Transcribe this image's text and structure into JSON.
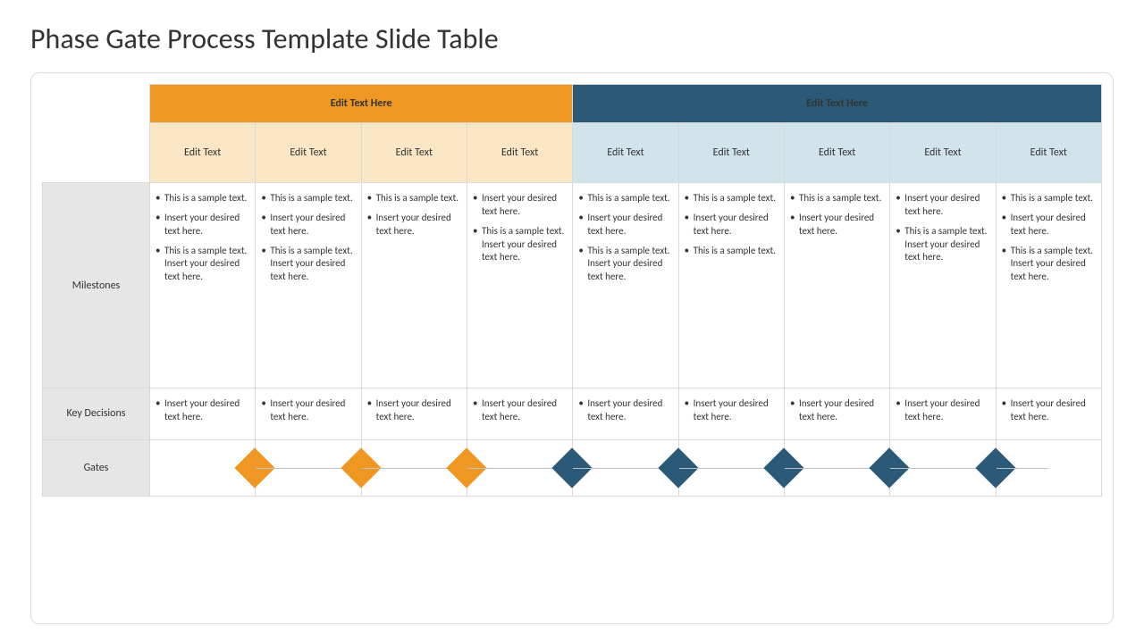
{
  "slide": {
    "title": "Phase Gate Process Template Slide Table"
  },
  "headers": {
    "groupLeft": "Edit Text Here",
    "groupRight": "Edit Text Here",
    "cols": [
      "Edit Text",
      "Edit Text",
      "Edit Text",
      "Edit Text",
      "Edit Text",
      "Edit Text",
      "Edit Text",
      "Edit Text",
      "Edit Text"
    ]
  },
  "rowLabels": {
    "milestones": "Milestones",
    "keyDecisions": "Key Decisions",
    "gates": "Gates"
  },
  "milestones": [
    [
      "This is a sample text.",
      "Insert your desired text here.",
      "This is a sample text. Insert your desired text here."
    ],
    [
      "This is a sample text.",
      "Insert your desired text here.",
      "This is a sample text. Insert your desired text here."
    ],
    [
      "This is a sample text.",
      "Insert your desired text here."
    ],
    [
      "Insert your desired text here.",
      "This is a sample text. Insert your desired text here."
    ],
    [
      "This is a sample text.",
      "Insert your desired text here.",
      "This is a sample text. Insert your desired text here."
    ],
    [
      "This is a sample text.",
      "Insert your desired text here.",
      "This is a sample text."
    ],
    [
      "This is a sample text.",
      "Insert your desired text here."
    ],
    [
      "Insert your desired text here.",
      "This is a sample text. Insert your desired text here."
    ],
    [
      "This is a sample text.",
      "Insert your desired text here.",
      "This is a sample text. Insert your desired text here."
    ]
  ],
  "keyDecisions": [
    [
      "Insert your desired text here."
    ],
    [
      "Insert your desired text here."
    ],
    [
      "Insert your desired text here."
    ],
    [
      "Insert your desired text here."
    ],
    [
      "Insert your desired text here."
    ],
    [
      "Insert your desired text here."
    ],
    [
      "Insert your desired text here."
    ],
    [
      "Insert your desired text here."
    ],
    [
      "Insert your desired text here."
    ]
  ],
  "gates": [
    {
      "diamond": "orange",
      "line": "none"
    },
    {
      "diamond": "orange",
      "line": "full"
    },
    {
      "diamond": "orange",
      "line": "full"
    },
    {
      "diamond": "blue",
      "line": "full"
    },
    {
      "diamond": "blue",
      "line": "full"
    },
    {
      "diamond": "blue",
      "line": "full"
    },
    {
      "diamond": "blue",
      "line": "full"
    },
    {
      "diamond": "blue",
      "line": "full"
    },
    {
      "diamond": null,
      "line": "left-half"
    }
  ],
  "colors": {
    "orange": "#ee9823",
    "blue": "#2a5a77"
  }
}
